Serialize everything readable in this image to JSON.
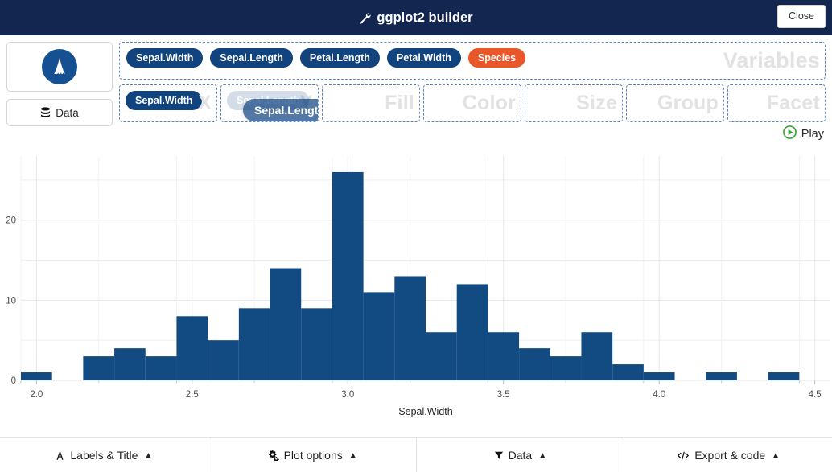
{
  "header": {
    "title": "ggplot2 builder",
    "icon": "wrench-icon",
    "close_label": "Close"
  },
  "left_panel": {
    "logo_icon": "ggplot-logo-icon",
    "data_label": "Data",
    "data_icon": "database-icon"
  },
  "variables": {
    "watermark": "Variables",
    "items": [
      {
        "label": "Sepal.Width",
        "type": "numeric"
      },
      {
        "label": "Sepal.Length",
        "type": "numeric"
      },
      {
        "label": "Petal.Length",
        "type": "numeric"
      },
      {
        "label": "Petal.Width",
        "type": "numeric"
      },
      {
        "label": "Species",
        "type": "factor"
      }
    ],
    "colors": {
      "numeric": "#11447f",
      "factor": "#e8562a"
    }
  },
  "dropzones": [
    {
      "name": "x",
      "watermark": "X",
      "value": "Sepal.Width",
      "state": "filled"
    },
    {
      "name": "y",
      "watermark": "Y",
      "value": "Sepal.Length",
      "state": "dragging",
      "drag_value": "Sepal.Length"
    },
    {
      "name": "fill",
      "watermark": "Fill",
      "value": "",
      "state": "empty"
    },
    {
      "name": "color",
      "watermark": "Color",
      "value": "",
      "state": "empty"
    },
    {
      "name": "size",
      "watermark": "Size",
      "value": "",
      "state": "empty"
    },
    {
      "name": "group",
      "watermark": "Group",
      "value": "",
      "state": "empty"
    },
    {
      "name": "facet",
      "watermark": "Facet",
      "value": "",
      "state": "empty"
    }
  ],
  "play": {
    "label": "Play",
    "icon": "play-circle-icon",
    "color": "#3aa33a"
  },
  "chart_data": {
    "type": "bar",
    "title": "",
    "xlabel": "Sepal.Width",
    "ylabel": "",
    "xlim": [
      1.95,
      4.55
    ],
    "ylim": [
      0,
      28
    ],
    "xticks": [
      2.0,
      2.5,
      3.0,
      3.5,
      4.0,
      4.5
    ],
    "xtick_labels": [
      "2.0",
      "2.5",
      "3.0",
      "3.5",
      "4.0",
      "4.5"
    ],
    "yticks": [
      0,
      10,
      20
    ],
    "ytick_labels": [
      "0",
      "10",
      "20"
    ],
    "yminor": [
      5,
      15,
      25
    ],
    "grid": true,
    "legend": "none",
    "bar_color": "#114b82",
    "bin_width": 0.1,
    "bins": [
      {
        "x": 2.0,
        "value": 1
      },
      {
        "x": 2.2,
        "value": 3
      },
      {
        "x": 2.3,
        "value": 4
      },
      {
        "x": 2.4,
        "value": 3
      },
      {
        "x": 2.5,
        "value": 8
      },
      {
        "x": 2.6,
        "value": 5
      },
      {
        "x": 2.7,
        "value": 9
      },
      {
        "x": 2.8,
        "value": 14
      },
      {
        "x": 2.9,
        "value": 9
      },
      {
        "x": 3.0,
        "value": 26
      },
      {
        "x": 3.1,
        "value": 11
      },
      {
        "x": 3.2,
        "value": 13
      },
      {
        "x": 3.3,
        "value": 6
      },
      {
        "x": 3.4,
        "value": 12
      },
      {
        "x": 3.5,
        "value": 6
      },
      {
        "x": 3.6,
        "value": 4
      },
      {
        "x": 3.7,
        "value": 3
      },
      {
        "x": 3.8,
        "value": 6
      },
      {
        "x": 3.9,
        "value": 2
      },
      {
        "x": 4.0,
        "value": 1
      },
      {
        "x": 4.2,
        "value": 1
      },
      {
        "x": 4.4,
        "value": 1
      }
    ]
  },
  "footer": {
    "panels": [
      {
        "label": "Labels & Title",
        "icon": "font-icon",
        "caret": "▲"
      },
      {
        "label": "Plot options",
        "icon": "gears-icon",
        "caret": "▲"
      },
      {
        "label": "Data",
        "icon": "filter-icon",
        "caret": "▲"
      },
      {
        "label": "Export & code",
        "icon": "code-icon",
        "caret": "▲"
      }
    ]
  }
}
